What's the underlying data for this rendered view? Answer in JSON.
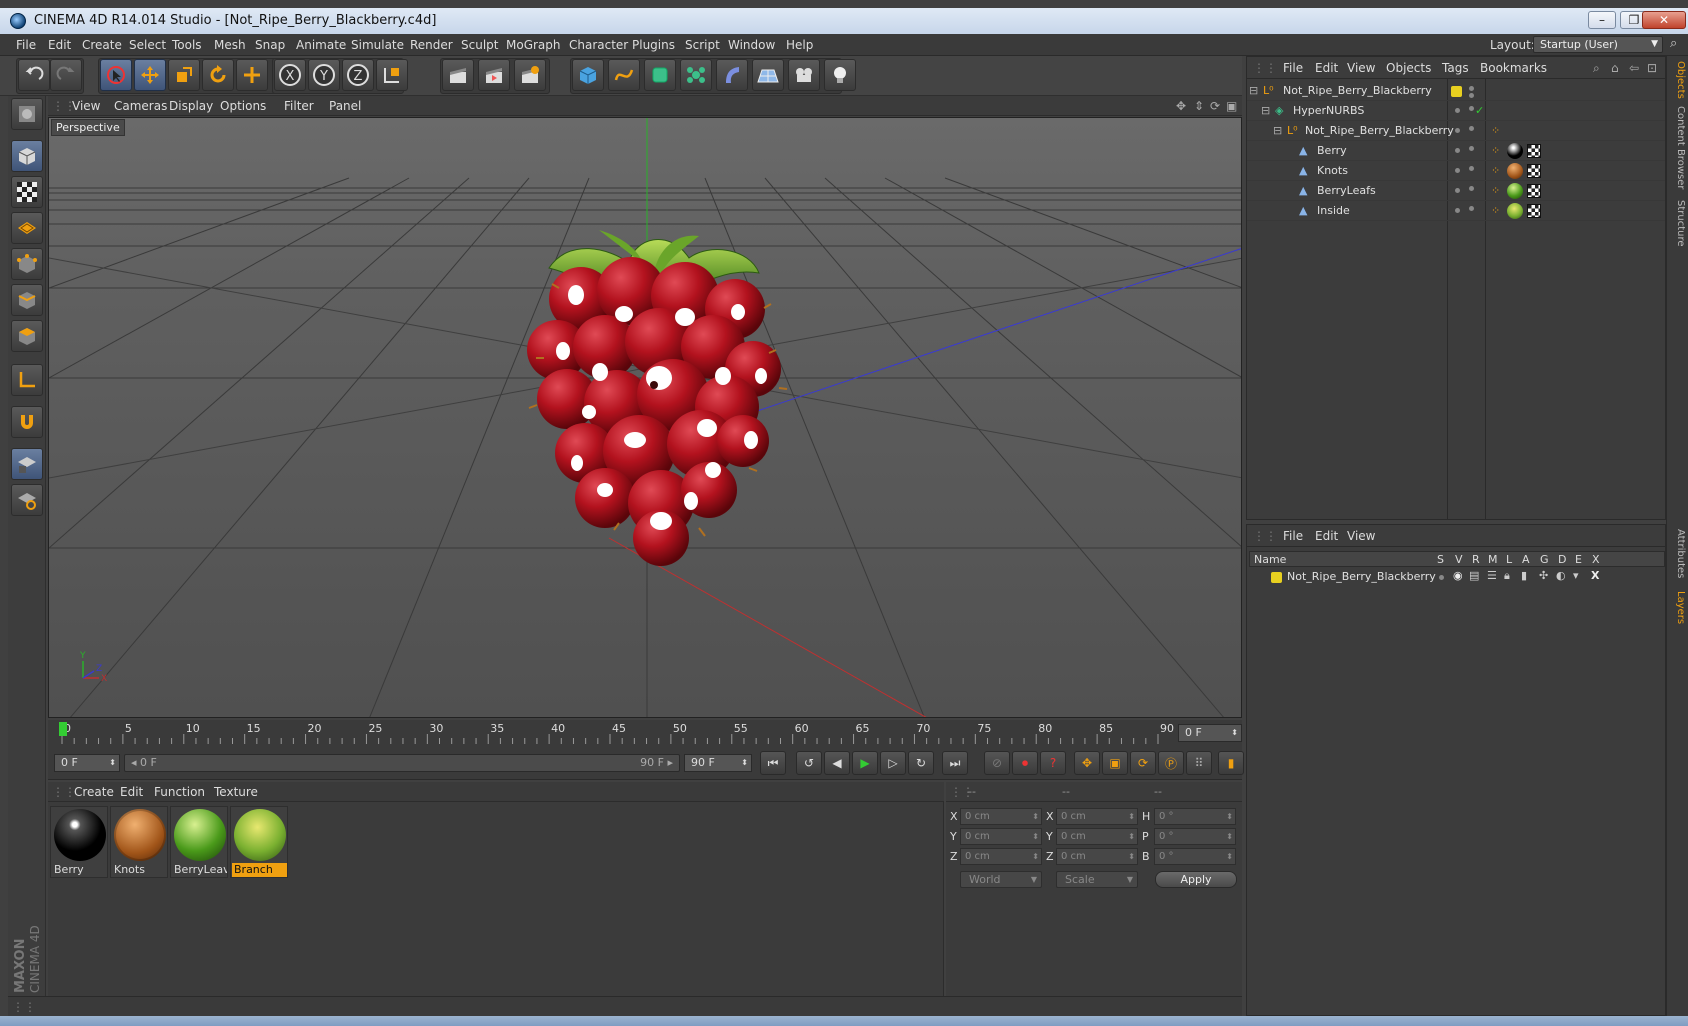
{
  "window": {
    "title": "CINEMA 4D R14.014 Studio - [Not_Ripe_Berry_Blackberry.c4d]"
  },
  "menubar": {
    "items": [
      "File",
      "Edit",
      "Create",
      "Select",
      "Tools",
      "Mesh",
      "Snap",
      "Animate",
      "Simulate",
      "Render",
      "Sculpt",
      "MoGraph",
      "Character",
      "Plugins",
      "Script",
      "Window",
      "Help"
    ],
    "layout_label": "Layout:",
    "layout_value": "Startup (User)"
  },
  "viewport": {
    "menu": [
      "View",
      "Cameras",
      "Display",
      "Options",
      "Filter",
      "Panel"
    ],
    "label": "Perspective"
  },
  "timeline": {
    "ticks": [
      "0",
      "5",
      "10",
      "15",
      "20",
      "25",
      "30",
      "35",
      "40",
      "45",
      "50",
      "55",
      "60",
      "65",
      "70",
      "75",
      "80",
      "85",
      "90"
    ],
    "current_frame_field": "0 F"
  },
  "transport": {
    "start_field": "0 F",
    "range_start": "0 F",
    "range_end": "90 F",
    "end_field": "90 F"
  },
  "materials": {
    "menu": [
      "Create",
      "Edit",
      "Function",
      "Texture"
    ],
    "items": [
      {
        "label": "Berry",
        "selected": false
      },
      {
        "label": "Knots",
        "selected": false
      },
      {
        "label": "BerryLeave",
        "selected": false
      },
      {
        "label": "Branch",
        "selected": true
      }
    ]
  },
  "coordinates": {
    "header": [
      "--",
      "--",
      "--"
    ],
    "rows": [
      {
        "a": "X",
        "a_val": "0 cm",
        "b": "X",
        "b_val": "0 cm",
        "c": "H",
        "c_val": "0 °"
      },
      {
        "a": "Y",
        "a_val": "0 cm",
        "b": "Y",
        "b_val": "0 cm",
        "c": "P",
        "c_val": "0 °"
      },
      {
        "a": "Z",
        "a_val": "0 cm",
        "b": "Z",
        "b_val": "0 cm",
        "c": "B",
        "c_val": "0 °"
      }
    ],
    "mode": "World",
    "transform": "Scale",
    "apply": "Apply"
  },
  "object_manager": {
    "menu": [
      "File",
      "Edit",
      "View",
      "Objects",
      "Tags",
      "Bookmarks"
    ],
    "objects": [
      {
        "name": "Not_Ripe_Berry_Blackberry"
      },
      {
        "name": "HyperNURBS"
      },
      {
        "name": "Not_Ripe_Berry_Blackberry"
      },
      {
        "name": "Berry"
      },
      {
        "name": "Knots"
      },
      {
        "name": "BerryLeafs"
      },
      {
        "name": "Inside"
      }
    ]
  },
  "layer_manager": {
    "menu": [
      "File",
      "Edit",
      "View"
    ],
    "columns": [
      "Name",
      "S",
      "V",
      "R",
      "M",
      "L",
      "A",
      "G",
      "D",
      "E",
      "X"
    ],
    "layers": [
      {
        "name": "Not_Ripe_Berry_Blackberry",
        "color": "#e8d020"
      }
    ]
  },
  "right_tabs": [
    "Objects",
    "Content Browser",
    "Structure",
    "Attributes",
    "Layers"
  ],
  "brand": {
    "maxon": "MAXON",
    "product": "CINEMA 4D"
  }
}
